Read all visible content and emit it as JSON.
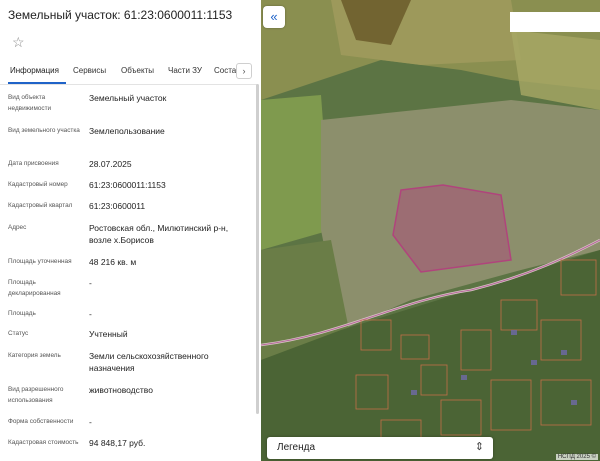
{
  "title": "Земельный участок: 61:23:0600011:1153",
  "tabs": [
    {
      "label": "Информация",
      "active": true
    },
    {
      "label": "Сервисы"
    },
    {
      "label": "Объекты"
    },
    {
      "label": "Части ЗУ"
    },
    {
      "label": "Соста"
    }
  ],
  "properties": [
    {
      "label": "Вид объекта недвижимости",
      "value": "Земельный участок"
    },
    {
      "label": "Вид земельного участка",
      "value": "Землепользование"
    },
    {
      "label": "Дата присвоения",
      "value": "28.07.2025"
    },
    {
      "label": "Кадастровый номер",
      "value": "61:23:0600011:1153"
    },
    {
      "label": "Кадастровый квартал",
      "value": "61:23:0600011"
    },
    {
      "label": "Адрес",
      "value": "Ростовская обл., Милютинский р-н, возле х.Борисов"
    },
    {
      "label": "Площадь уточненная",
      "value": "48 216 кв. м"
    },
    {
      "label": "Площадь декларированная",
      "value": "-"
    },
    {
      "label": "Площадь",
      "value": "-"
    },
    {
      "label": "Статус",
      "value": "Учтенный"
    },
    {
      "label": "Категория земель",
      "value": "Земли сельскохозяйственного назначения"
    },
    {
      "label": "Вид разрешенного использования",
      "value": "животноводство"
    },
    {
      "label": "Форма собственности",
      "value": "-"
    },
    {
      "label": "Кадастровая стоимость",
      "value": "94 848,17 руб."
    }
  ],
  "map": {
    "legend_label": "Легенда",
    "attribution": "НСПД 2025 ©",
    "parcel_highlight_color": "#b0447c"
  }
}
